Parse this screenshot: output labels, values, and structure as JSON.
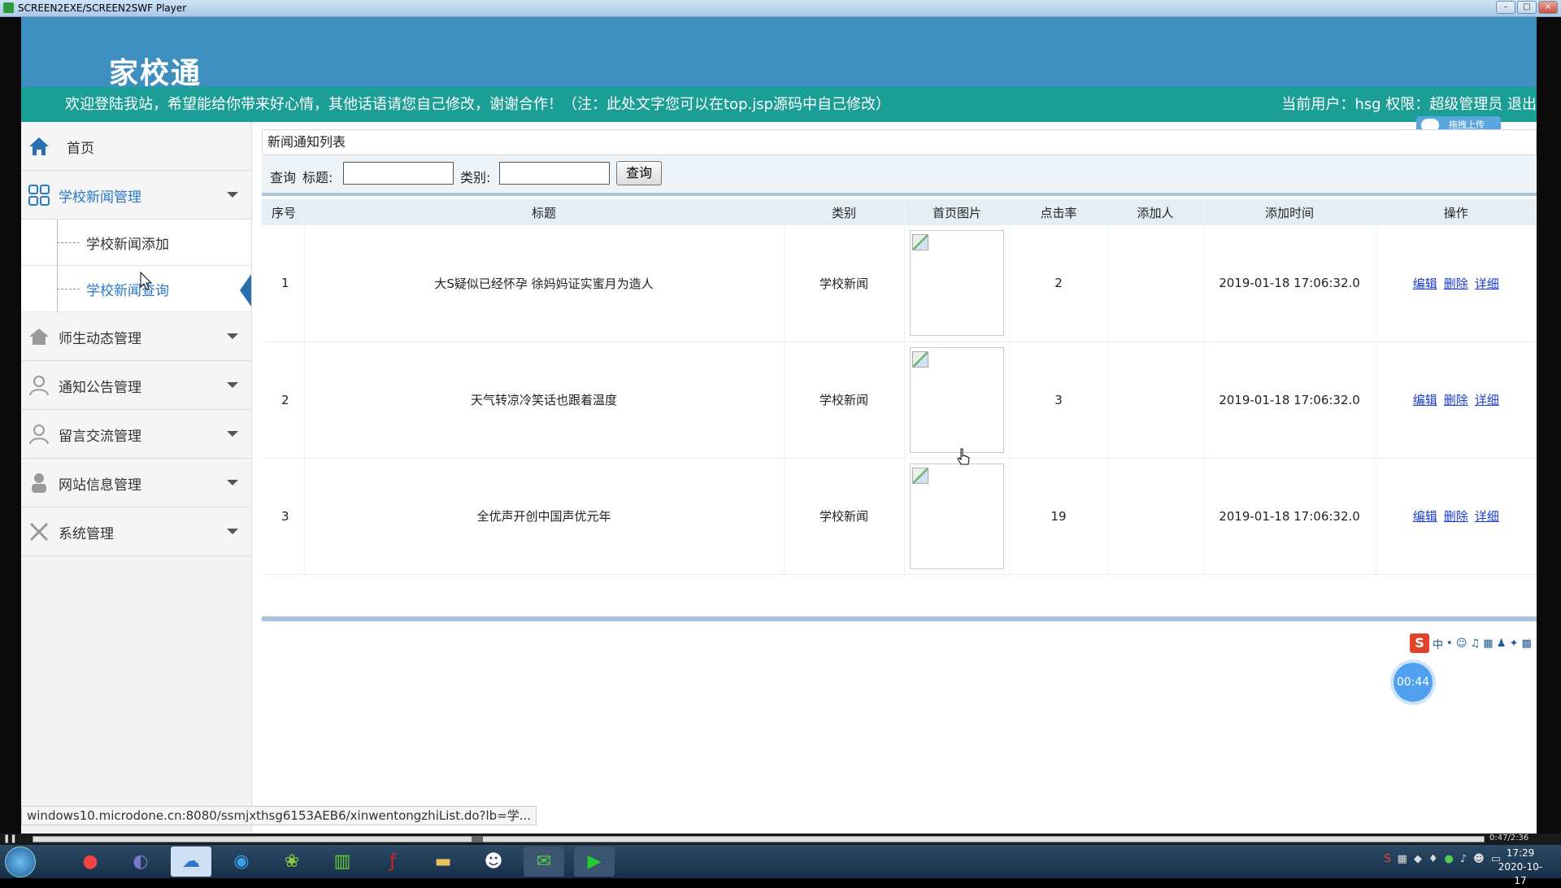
{
  "window": {
    "title": "SCREEN2EXE/SCREEN2SWF Player"
  },
  "header": {
    "logo": "家校通"
  },
  "welcome": {
    "message": "欢迎登陆我站，希望能给你带来好心情，其他话语请您自己修改，谢谢合作！（注：此处文字您可以在top.jsp源码中自己修改）",
    "user_info": "当前用户：hsg  权限：超级管理员 退出"
  },
  "upload": {
    "label": "拖拽上传"
  },
  "sidebar": {
    "home": "首页",
    "items": [
      {
        "label": "学校新闻管理"
      },
      {
        "label": "学校新闻添加"
      },
      {
        "label": "学校新闻查询"
      },
      {
        "label": "师生动态管理"
      },
      {
        "label": "通知公告管理"
      },
      {
        "label": "留言交流管理"
      },
      {
        "label": "网站信息管理"
      },
      {
        "label": "系统管理"
      }
    ]
  },
  "panel": {
    "title": "新闻通知列表"
  },
  "search": {
    "query_label": "查询",
    "title_label": "标题:",
    "title_value": "",
    "category_label": "类别:",
    "category_value": "",
    "button": "查询"
  },
  "table": {
    "headers": [
      "序号",
      "标题",
      "类别",
      "首页图片",
      "点击率",
      "添加人",
      "添加时间",
      "操作"
    ],
    "rows": [
      {
        "id": "1",
        "title": "大S疑似已经怀孕 徐妈妈证实蜜月为造人",
        "category": "学校新闻",
        "clicks": "2",
        "adder": "",
        "time": "2019-01-18 17:06:32.0"
      },
      {
        "id": "2",
        "title": "天气转凉冷笑话也跟着温度",
        "category": "学校新闻",
        "clicks": "3",
        "adder": "",
        "time": "2019-01-18 17:06:32.0"
      },
      {
        "id": "3",
        "title": "全优声开创中国声优元年",
        "category": "学校新闻",
        "clicks": "19",
        "adder": "",
        "time": "2019-01-18 17:06:32.0"
      }
    ],
    "ops": {
      "edit": "编辑",
      "delete": "删除",
      "detail": "详细"
    }
  },
  "ime": {
    "logo": "S",
    "lang": "中"
  },
  "timer": {
    "value": "00:44"
  },
  "status": {
    "url": "windows10.microdone.cn:8080/ssmjxthsg6153AEB6/xinwentongzhiList.do?lb=学..."
  },
  "player": {
    "time": "0:47/2:36"
  },
  "clock": {
    "time": "17:29",
    "date": "2020-10-17"
  },
  "colors": {
    "header": "#3d8fbf",
    "welcome_bar": "#1a9e96",
    "link": "#1a3cd1",
    "active": "#2a77c9"
  }
}
